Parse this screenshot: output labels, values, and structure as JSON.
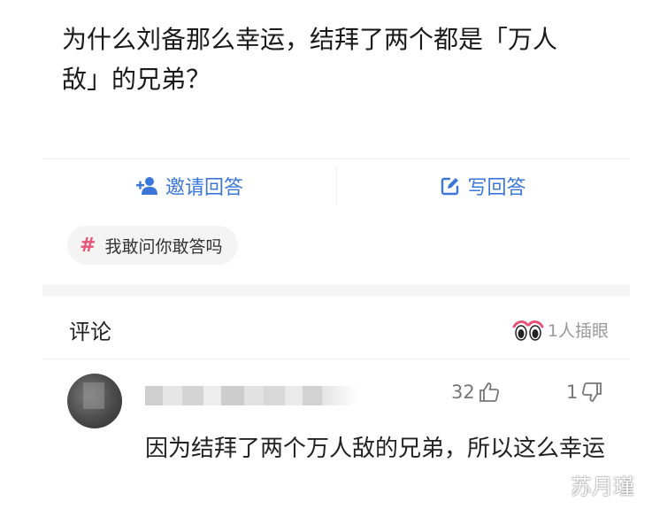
{
  "question": {
    "title": "为什么刘备那么幸运，结拜了两个都是「万人敌」的兄弟？"
  },
  "actions": {
    "invite_label": "邀请回答",
    "write_label": "写回答"
  },
  "topic": {
    "label": "我敢问你敢答吗"
  },
  "comments": {
    "title": "评论",
    "watchers": "1人插眼",
    "items": [
      {
        "text": "因为结拜了两个万人敌的兄弟，所以这么幸运",
        "likes": "32",
        "dislikes": "1"
      }
    ]
  },
  "watermark": "苏月瑾",
  "colors": {
    "accent": "#3b77d8",
    "topic_hash": "#e8537a",
    "muted": "#999999"
  }
}
